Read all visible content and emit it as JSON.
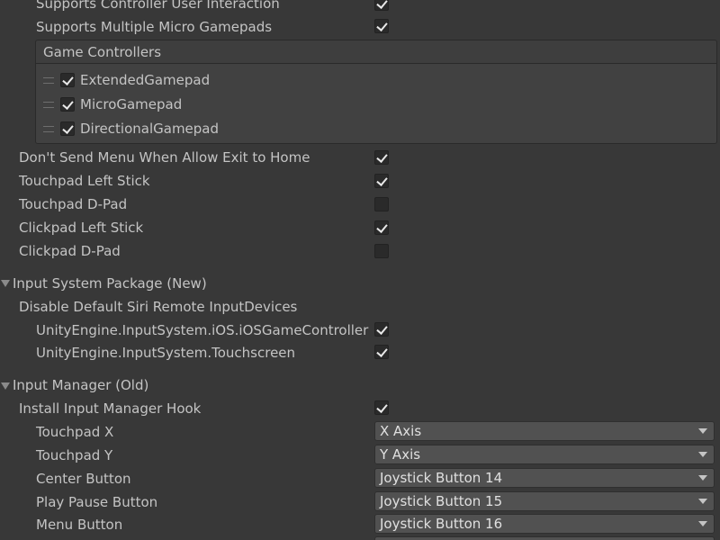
{
  "apple_tv": {
    "supports_user_interaction": {
      "label": "Supports Controller User Interaction",
      "checked": true
    },
    "supports_multiple_micro": {
      "label": "Supports Multiple Micro Gamepads",
      "checked": true
    },
    "game_controllers": {
      "header": "Game Controllers",
      "items": [
        {
          "label": "ExtendedGamepad",
          "checked": true
        },
        {
          "label": "MicroGamepad",
          "checked": true
        },
        {
          "label": "DirectionalGamepad",
          "checked": true
        }
      ]
    },
    "dont_send_menu": {
      "label": "Don't Send Menu When Allow Exit to Home",
      "checked": true
    },
    "touchpad_left_stick": {
      "label": "Touchpad Left Stick",
      "checked": true
    },
    "touchpad_dpad": {
      "label": "Touchpad D-Pad",
      "checked": false
    },
    "clickpad_left_stick": {
      "label": "Clickpad Left Stick",
      "checked": true
    },
    "clickpad_dpad": {
      "label": "Clickpad D-Pad",
      "checked": false
    }
  },
  "input_system": {
    "header": "Input System Package (New)",
    "disable_default_label": "Disable Default Siri Remote InputDevices",
    "devices": [
      {
        "label": "UnityEngine.InputSystem.iOS.iOSGameController",
        "checked": true
      },
      {
        "label": "UnityEngine.InputSystem.Touchscreen",
        "checked": true
      }
    ]
  },
  "input_manager": {
    "header": "Input Manager (Old)",
    "install_hook": {
      "label": "Install Input Manager Hook",
      "checked": true
    },
    "mappings": [
      {
        "label": "Touchpad X",
        "value": "X Axis"
      },
      {
        "label": "Touchpad Y",
        "value": "Y Axis"
      },
      {
        "label": "Center Button",
        "value": "Joystick Button 14"
      },
      {
        "label": "Play Pause Button",
        "value": "Joystick Button 15"
      },
      {
        "label": "Menu Button",
        "value": "Joystick Button 16"
      }
    ]
  }
}
